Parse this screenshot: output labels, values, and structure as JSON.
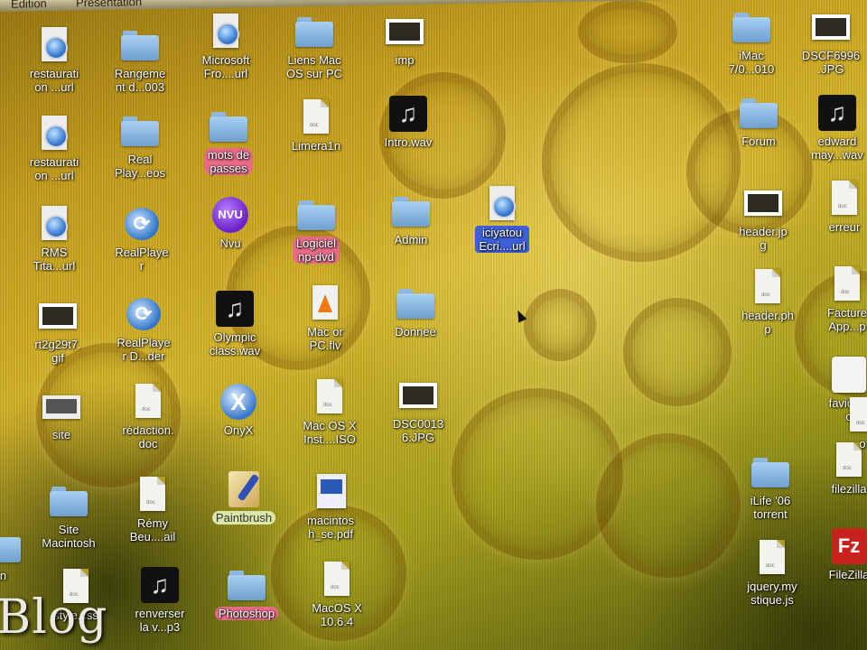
{
  "menubar": {
    "items": [
      "Édition",
      "Présentation"
    ]
  },
  "watermark": "Blog",
  "desktop_icons": [
    {
      "label": "restaurati\non ...url"
    },
    {
      "label": "Rangeme\nnt d...003"
    },
    {
      "label": "Microsoft\nFro....url"
    },
    {
      "label": "Liens Mac\nOS sur PC"
    },
    {
      "label": "imp"
    },
    {
      "label": "iMac\n7/0...010"
    },
    {
      "label": "DSCF6996\n.JPG"
    },
    {
      "label": "restaurati\non ...url"
    },
    {
      "label": "Real\nPlay...eos"
    },
    {
      "label": "mots de\npasses"
    },
    {
      "label": "Limera1n"
    },
    {
      "label": "Intro.wav"
    },
    {
      "label": "Forum"
    },
    {
      "label": "edward\nmay...wav"
    },
    {
      "label": "RMS\nTita...url"
    },
    {
      "label": "RealPlaye\nr"
    },
    {
      "label": "Nvu"
    },
    {
      "label": "Logiciel\nnp-dvd"
    },
    {
      "label": "Admin"
    },
    {
      "label": "iciyatou\nEcri....url"
    },
    {
      "label": "header.jp\ng"
    },
    {
      "label": "erreur"
    },
    {
      "label": "rt2g29t7.\ngif"
    },
    {
      "label": "RealPlaye\nr D...der"
    },
    {
      "label": "Olympic\nclass.wav"
    },
    {
      "label": "Mac or\nPC.flv"
    },
    {
      "label": "Donnee"
    },
    {
      "label": "header.ph\np"
    },
    {
      "label": "Facture\nApp...p"
    },
    {
      "label": "site"
    },
    {
      "label": "rédaction.\ndoc"
    },
    {
      "label": "OnyX"
    },
    {
      "label": "Mac OS X\nInst....ISO"
    },
    {
      "label": "DSC0013\n6.JPG"
    },
    {
      "label": "favicon.\no"
    },
    {
      "label": "Site\nMacintosh"
    },
    {
      "label": "Rémy\nBeu....ail"
    },
    {
      "label": "Paintbrush"
    },
    {
      "label": "macintos\nh_se.pdf"
    },
    {
      "label": "iLife '06\ntorrent"
    },
    {
      "label": "filezilla"
    },
    {
      "label": "style.css"
    },
    {
      "label": "renverser\nla v...p3"
    },
    {
      "label": "Photoshop"
    },
    {
      "label": "MacOS X\n10.6.4"
    },
    {
      "label": "jquery.my\nstique.js"
    },
    {
      "label": "FileZilla"
    },
    {
      "label": "in"
    },
    {
      "label": "o"
    }
  ]
}
